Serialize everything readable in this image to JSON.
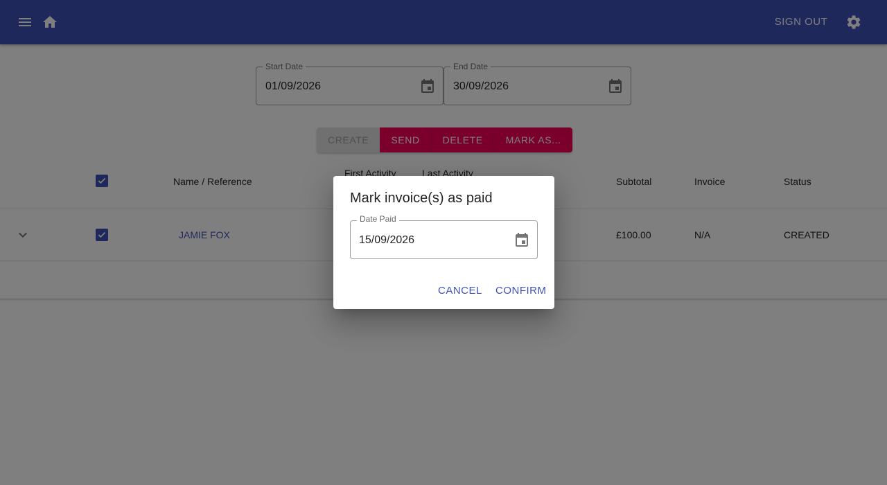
{
  "appbar": {
    "menu_icon": "menu-icon",
    "home_icon": "home-icon",
    "sign_out": "Sign out",
    "settings_icon": "gear-icon",
    "color": "#3f51b5"
  },
  "filters": {
    "start_date": {
      "label": "Start Date",
      "value": "01/09/2026",
      "icon": "calendar-icon"
    },
    "end_date": {
      "label": "End Date",
      "value": "30/09/2026",
      "icon": "calendar-icon"
    }
  },
  "actions": {
    "create": "Create",
    "send": "Send",
    "delete": "Delete",
    "mark_as": "Mark as...",
    "accent": "#f50057"
  },
  "table": {
    "headers": {
      "name": "Name / Reference",
      "first_activity": "First Activity",
      "last_activity": "Last Activity",
      "subtotal": "Subtotal",
      "invoice": "Invoice",
      "status": "Status"
    },
    "rows": [
      {
        "name": "Jamie Fox",
        "subtotal": "£100.00",
        "invoice": "N/A",
        "status": "CREATED",
        "selected": true
      }
    ],
    "all_selected": true
  },
  "dialog": {
    "title": "Mark invoice(s) as paid",
    "date_label": "Date Paid",
    "date_value": "15/09/2026",
    "cancel": "Cancel",
    "confirm": "Confirm"
  }
}
